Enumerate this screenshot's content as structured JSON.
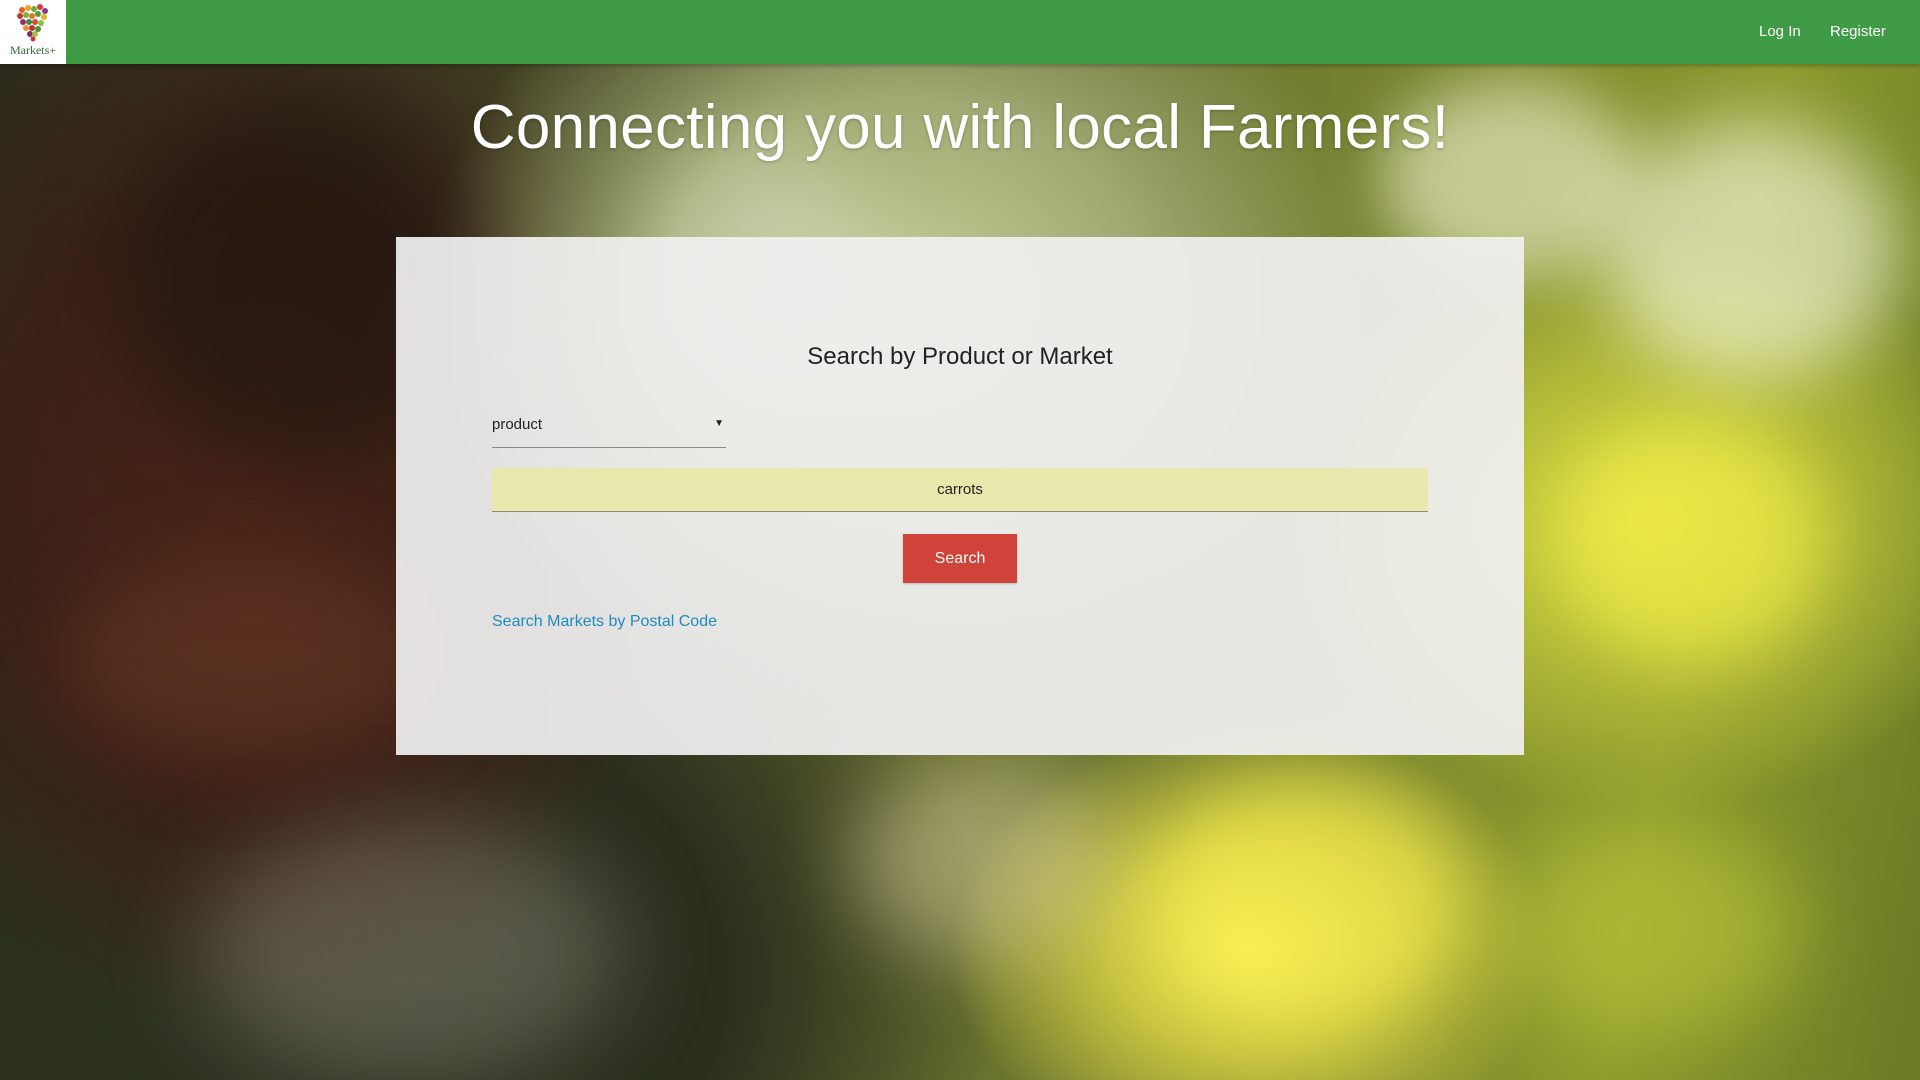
{
  "header": {
    "logo_text": "Markets+",
    "nav": {
      "login_label": "Log In",
      "register_label": "Register"
    }
  },
  "hero": {
    "title": "Connecting you with local Farmers!"
  },
  "search": {
    "title": "Search by Product or Market",
    "type_select": {
      "selected": "product",
      "caret_icon": "triangle-down-icon"
    },
    "query_value": "carrots",
    "button_label": "Search",
    "postal_link_label": "Search Markets by Postal Code"
  },
  "colors": {
    "header_green": "#3f9b45",
    "button_red": "#d0433a",
    "link_blue": "#1f8ac0",
    "input_highlight": "#e8e8ad"
  }
}
